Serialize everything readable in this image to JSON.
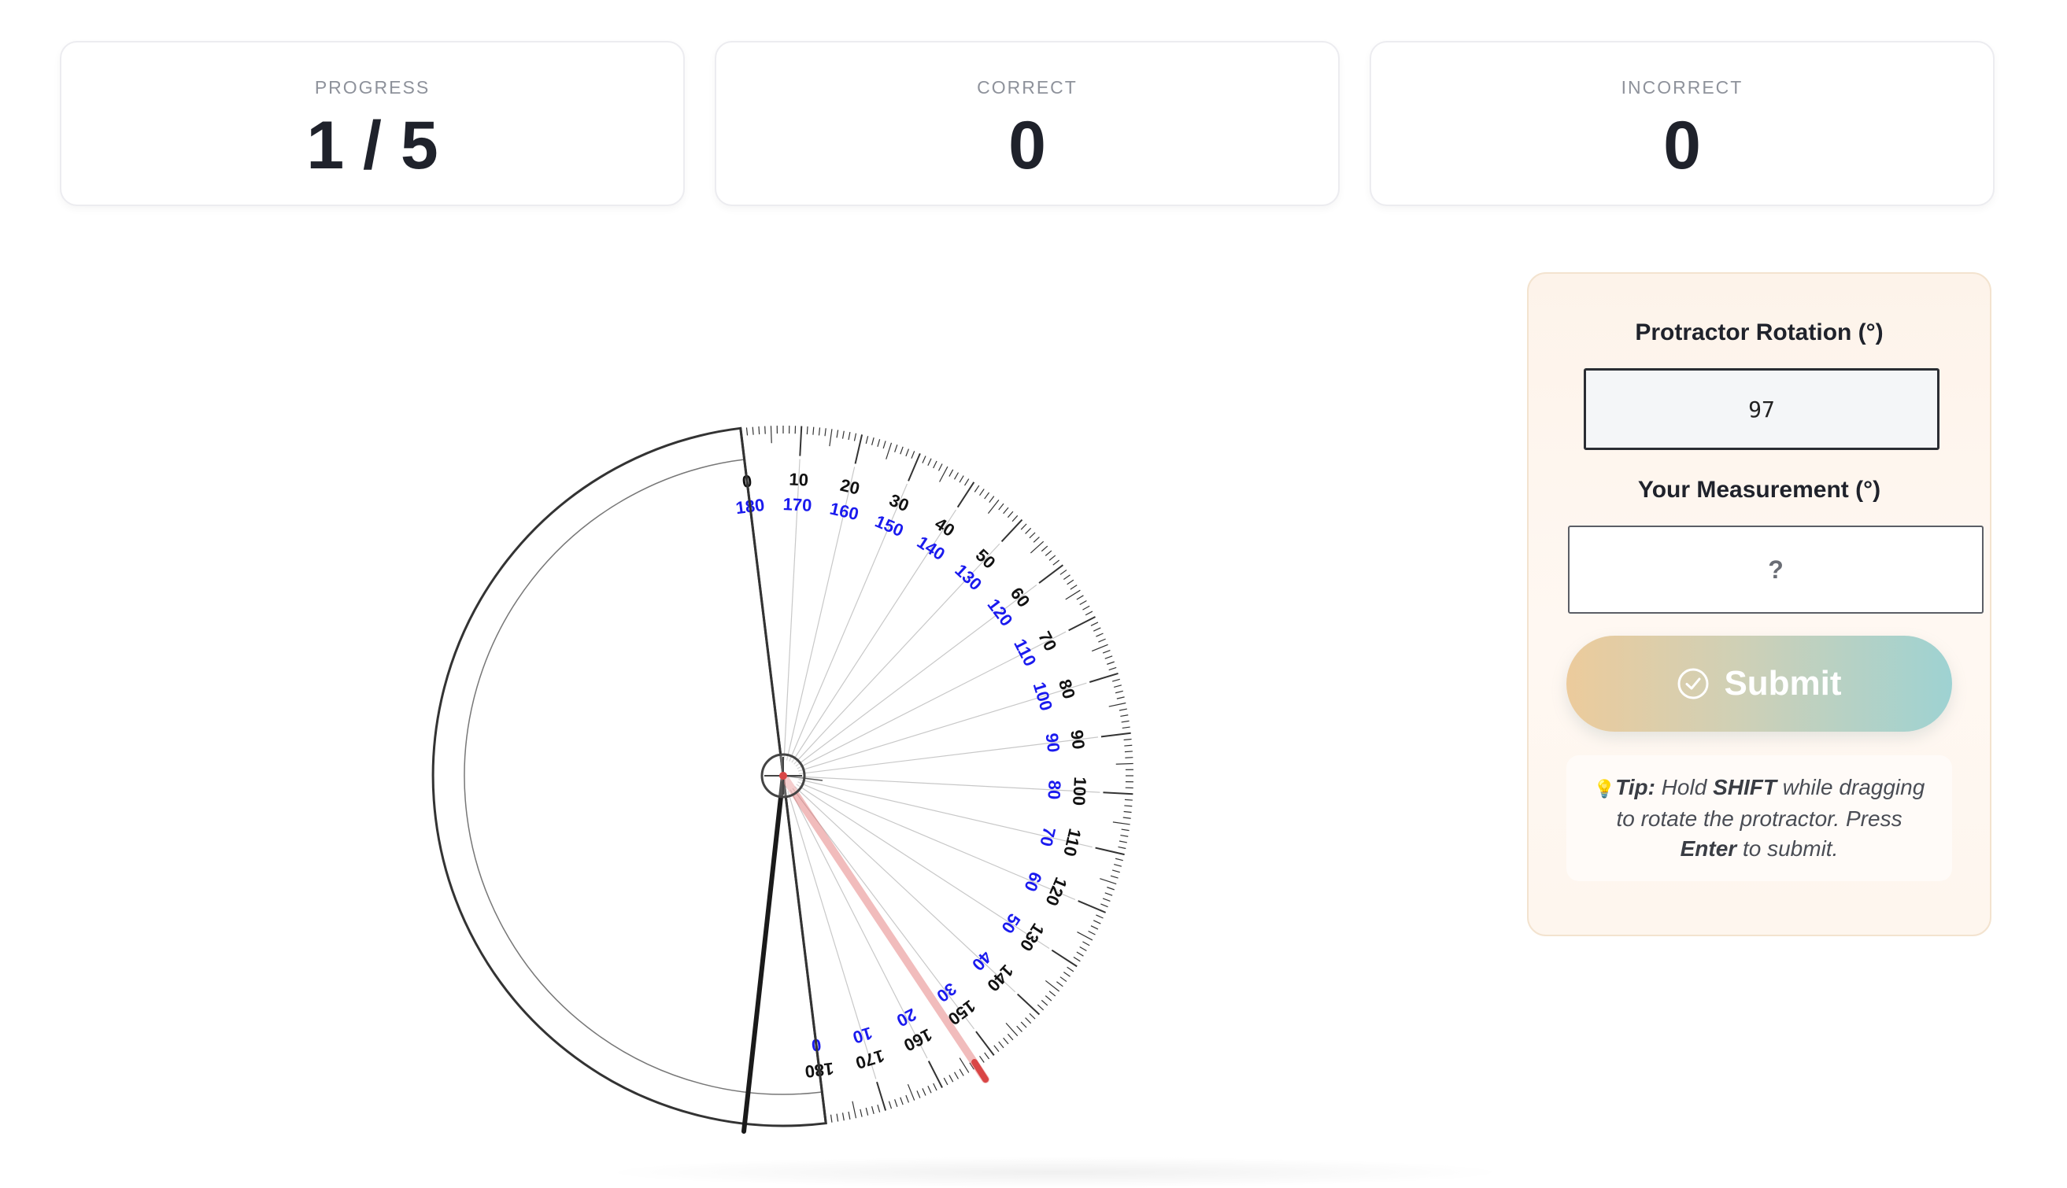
{
  "stats": [
    {
      "label": "PROGRESS",
      "value": "1 / 5"
    },
    {
      "label": "CORRECT",
      "value": "0"
    },
    {
      "label": "INCORRECT",
      "value": "0"
    }
  ],
  "controls": {
    "rotation_label": "Protractor Rotation (°)",
    "rotation_value": "97",
    "measurement_label": "Your Measurement (°)",
    "measurement_placeholder": "?",
    "submit_label": "Submit"
  },
  "tip": {
    "icon": "lightbulb-icon",
    "prefix": "Tip:",
    "text1": " Hold ",
    "key1": "SHIFT",
    "text2": " while dragging to rotate the protractor. Press ",
    "key2": "Enter",
    "text3": " to submit."
  },
  "protractor": {
    "rotation_deg": 97,
    "outer_scale": [
      "0",
      "10",
      "20",
      "30",
      "40",
      "50",
      "60",
      "70",
      "80",
      "90",
      "100",
      "110",
      "120",
      "130",
      "140",
      "150",
      "160",
      "170",
      "180"
    ],
    "inner_scale": [
      "180",
      "170",
      "160",
      "150",
      "140",
      "130",
      "120",
      "110",
      "100",
      "90",
      "80",
      "70",
      "60",
      "50",
      "40",
      "30",
      "20",
      "10",
      "0"
    ],
    "colors": {
      "outer_scale": "#111111",
      "inner_scale": "#1a1aee",
      "ray": "#e06a6a",
      "guide": "#c8c8c8"
    }
  }
}
